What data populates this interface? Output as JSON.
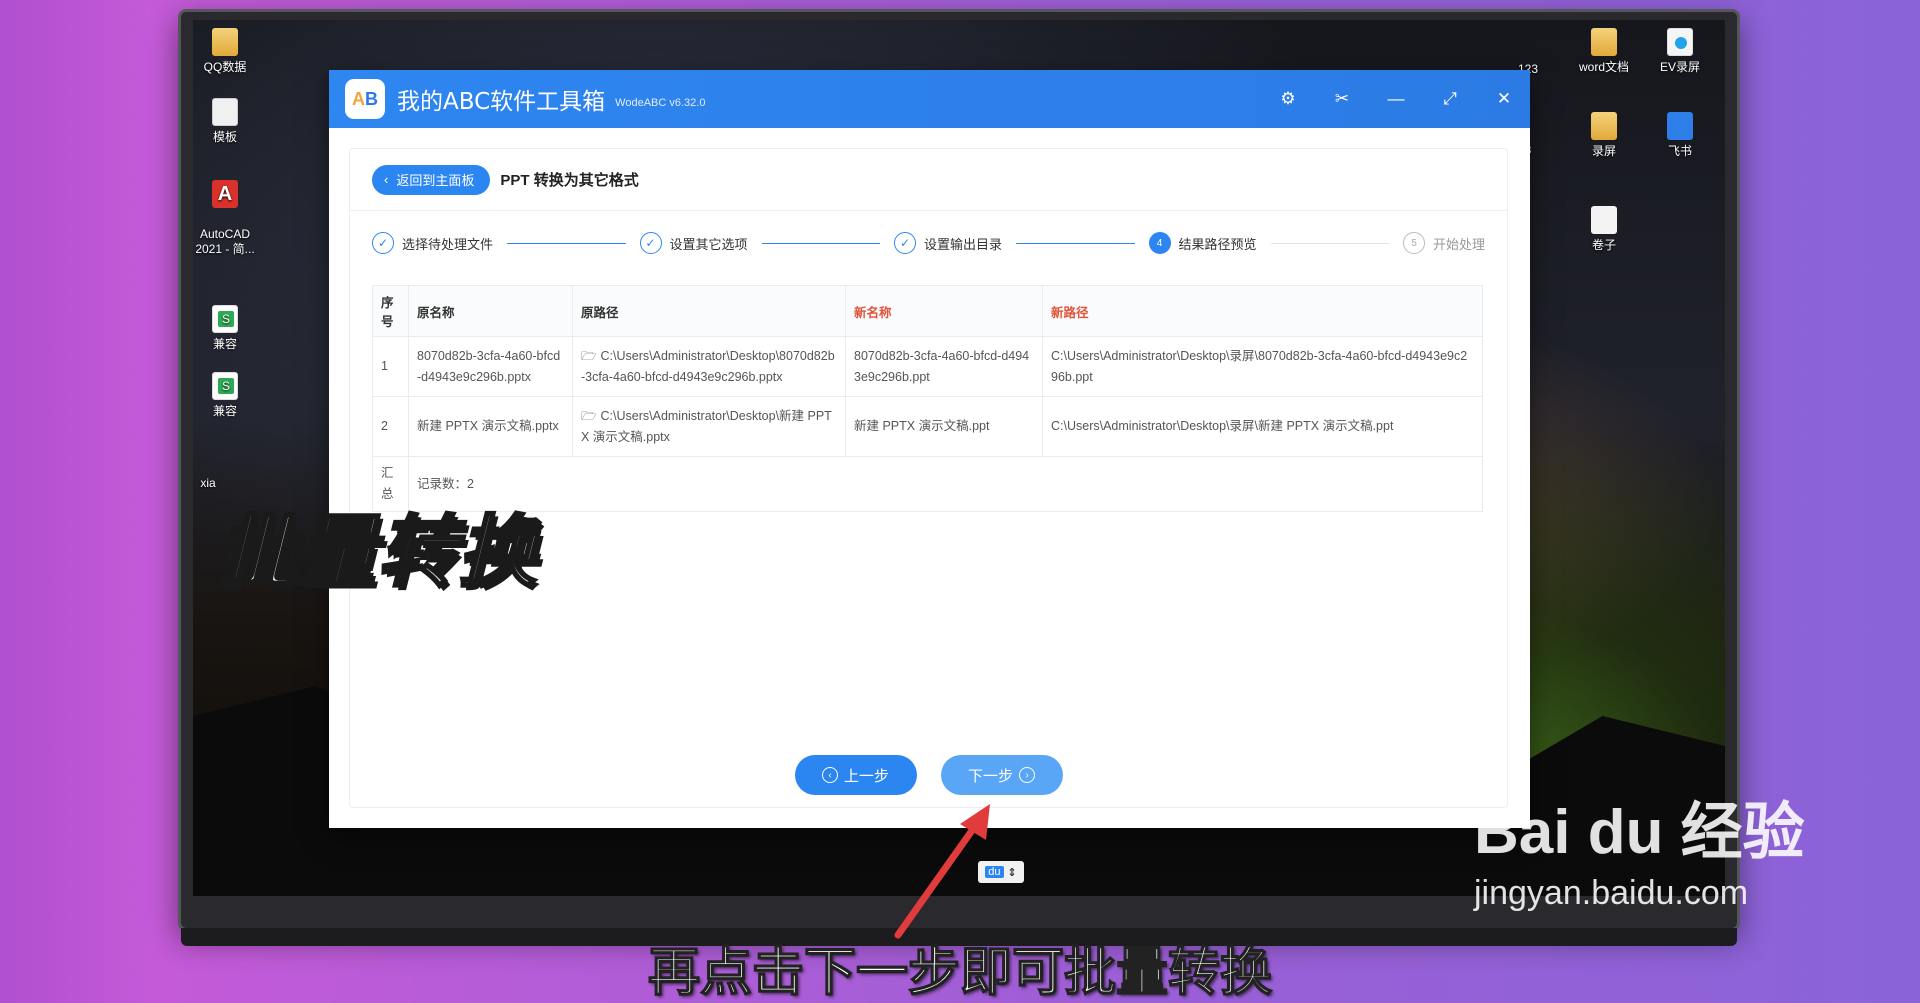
{
  "desktop": {
    "icons_left": [
      {
        "label": "QQ数据",
        "icon": "folder-icon"
      },
      {
        "label": "模板",
        "icon": "doc-icon"
      },
      {
        "label": "AutoCAD\n2021 - 简...",
        "icon": "autocad-icon"
      },
      {
        "label": "兼容",
        "icon": "spreadsheet-icon"
      },
      {
        "label": "兼容",
        "icon": "spreadsheet-icon"
      },
      {
        "label": "xia",
        "icon": "none"
      }
    ],
    "icons_right": [
      {
        "label": "123",
        "icon": "none"
      },
      {
        "label": "word文档",
        "icon": "folder-icon"
      },
      {
        "label": "EV录屏",
        "icon": "ev-icon"
      },
      {
        "label": "3",
        "icon": "none"
      },
      {
        "label": "录屏",
        "icon": "folder-icon"
      },
      {
        "label": "飞书",
        "icon": "feishu-icon"
      },
      {
        "label": "卷子",
        "icon": "scroll-icon"
      }
    ]
  },
  "app": {
    "title": "我的ABC软件工具箱",
    "version": "WodeABC v6.32.0",
    "logo_text": "AB",
    "controls": [
      "settings-icon",
      "scissors-icon",
      "minimize-icon",
      "maximize-icon",
      "close-icon"
    ],
    "back_label": "返回到主面板",
    "page_title": "PPT 转换为其它格式",
    "steps": [
      {
        "label": "选择待处理文件",
        "state": "done"
      },
      {
        "label": "设置其它选项",
        "state": "done"
      },
      {
        "label": "设置输出目录",
        "state": "done"
      },
      {
        "label": "结果路径预览",
        "state": "active",
        "num": "4"
      },
      {
        "label": "开始处理",
        "state": "todo",
        "num": "5"
      }
    ],
    "table": {
      "headers": [
        "序号",
        "原名称",
        "原路径",
        "新名称",
        "新路径"
      ],
      "rows": [
        {
          "no": "1",
          "orig_name": "8070d82b-3cfa-4a60-bfcd-d4943e9c296b.pptx",
          "orig_path": "C:\\Users\\Administrator\\Desktop\\8070d82b-3cfa-4a60-bfcd-d4943e9c296b.pptx",
          "new_name": "8070d82b-3cfa-4a60-bfcd-d4943e9c296b.ppt",
          "new_path": "C:\\Users\\Administrator\\Desktop\\录屏\\8070d82b-3cfa-4a60-bfcd-d4943e9c296b.ppt"
        },
        {
          "no": "2",
          "orig_name": "新建 PPTX 演示文稿.pptx",
          "orig_path": "C:\\Users\\Administrator\\Desktop\\新建 PPTX 演示文稿.pptx",
          "new_name": "新建 PPTX 演示文稿.ppt",
          "new_path": "C:\\Users\\Administrator\\Desktop\\录屏\\新建 PPTX 演示文稿.ppt"
        }
      ],
      "summary_label": "汇总",
      "summary_value": "记录数：2"
    },
    "prev_label": "上一步",
    "next_label": "下一步"
  },
  "ime": {
    "label": "du"
  },
  "overlay_title": "批量转换",
  "caption": "再点击下一步即可批量转换",
  "watermark": {
    "main": "Bai du 经验",
    "sub": "jingyan.baidu.com"
  },
  "colors": {
    "accent": "#2c86f2",
    "new_header": "#e0533a",
    "arrow": "#e23b3b"
  }
}
